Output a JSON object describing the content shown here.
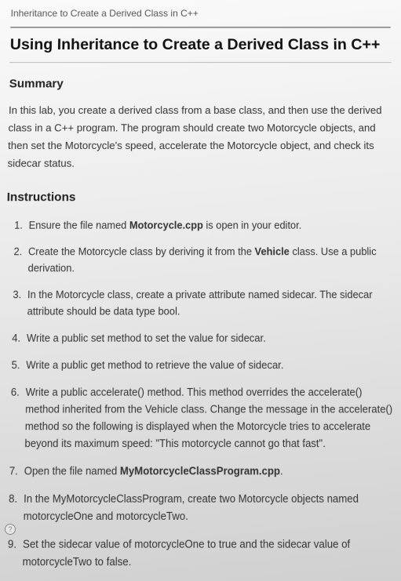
{
  "breadcrumb": "Inheritance to Create a Derived Class in C++",
  "title": "Using Inheritance to Create a Derived Class in C++",
  "summary": {
    "heading": "Summary",
    "text": "In this lab, you create a derived class from a base class, and then use the derived class in a C++ program. The program should create two Motorcycle objects, and then set the Motorcycle's speed, accelerate the Motorcycle object, and check its sidecar status."
  },
  "instructions": {
    "heading": "Instructions",
    "items": [
      {
        "pre": "Ensure the file named ",
        "bold": "Motorcycle.cpp",
        "post": " is open in your editor."
      },
      {
        "pre": "Create the Motorcycle class by deriving it from the ",
        "bold": "Vehicle",
        "post": " class. Use a public derivation."
      },
      {
        "pre": "In the Motorcycle class, create a private attribute named sidecar. The sidecar attribute should be data type bool.",
        "bold": "",
        "post": ""
      },
      {
        "pre": "Write a public set method to set the value for sidecar.",
        "bold": "",
        "post": ""
      },
      {
        "pre": "Write a public get method to retrieve the value of sidecar.",
        "bold": "",
        "post": ""
      },
      {
        "pre": "Write a public accelerate() method. This method overrides the accelerate() method inherited from the Vehicle class. Change the message in the accelerate() method so the following is displayed when the Motorcycle tries to accelerate beyond its maximum speed: \"This motorcycle cannot go that fast\".",
        "bold": "",
        "post": ""
      },
      {
        "pre": "Open the file named ",
        "bold": "MyMotorcycleClassProgram.cpp",
        "post": "."
      },
      {
        "pre": "In the MyMotorcycleClassProgram, create two Motorcycle objects named motorcycleOne and motorcycleTwo.",
        "bold": "",
        "post": ""
      },
      {
        "pre": "Set the sidecar value of motorcycleOne to true and the sidecar value of motorcycleTwo to false.",
        "bold": "",
        "post": ""
      }
    ]
  },
  "icon": {
    "label": "?"
  }
}
